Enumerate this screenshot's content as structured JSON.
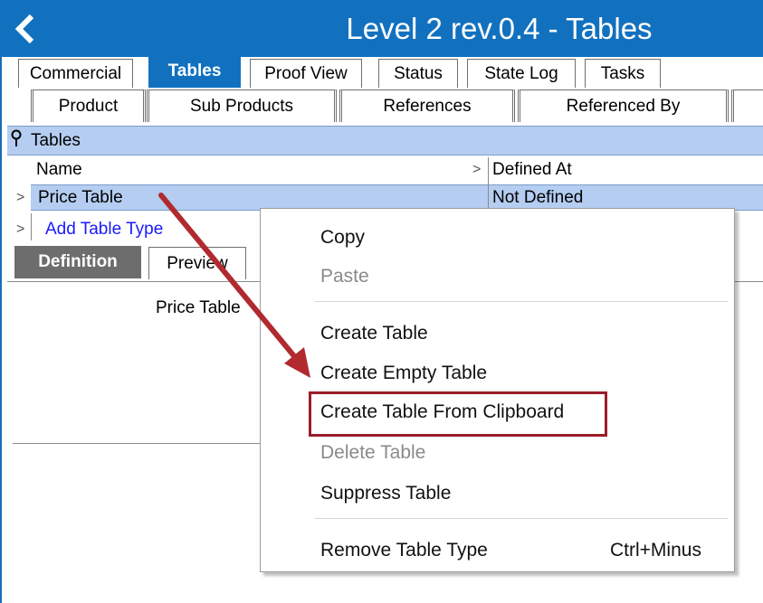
{
  "window": {
    "title": "Level 2 rev.0.4 - Tables",
    "back_icon": "chevron-left-icon"
  },
  "tabs_row1": [
    "Commercial",
    "Tables",
    "Proof View",
    "Status",
    "State Log",
    "Tasks"
  ],
  "tabs_row2": [
    "Product",
    "Sub Products",
    "References",
    "Referenced By"
  ],
  "tables_panel": {
    "header": "Tables",
    "columns": {
      "name": "Name",
      "defined_at": "Defined At"
    },
    "rows": [
      {
        "name": "Price Table",
        "defined_at": "Not Defined"
      }
    ],
    "add_link": "Add Table Type"
  },
  "subtabs": [
    "Definition",
    "Preview"
  ],
  "definition_label": "Price Table",
  "context_menu": {
    "items": [
      {
        "label": "Copy",
        "enabled": true
      },
      {
        "label": "Paste",
        "enabled": false
      },
      {
        "label": "Create Table",
        "enabled": true
      },
      {
        "label": "Create Empty Table",
        "enabled": true
      },
      {
        "label": "Create Table From Clipboard",
        "enabled": true,
        "highlighted": true
      },
      {
        "label": "Delete Table",
        "enabled": false
      },
      {
        "label": "Suppress Table",
        "enabled": true
      },
      {
        "label": "Remove Table Type",
        "enabled": true,
        "shortcut": "Ctrl+Minus"
      }
    ]
  },
  "colors": {
    "title_bar": "#1271bf",
    "selection": "#b4cdf1",
    "annotation": "#b02a2f"
  }
}
